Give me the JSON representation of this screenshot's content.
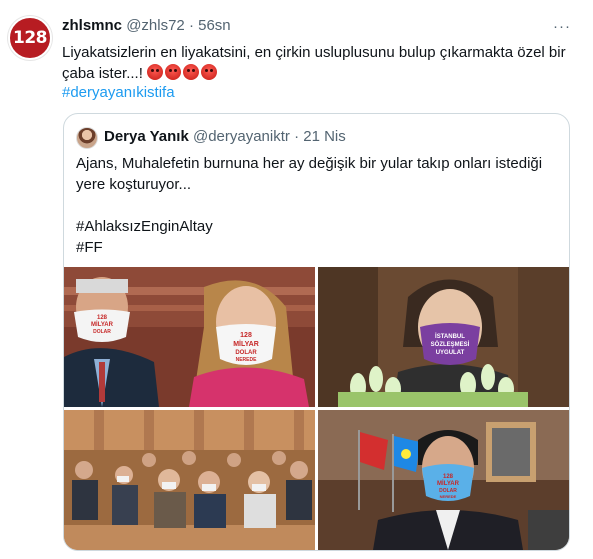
{
  "tweet": {
    "avatar_text": "128",
    "name": "zhlsmnc",
    "handle": "@zhls72",
    "time": "56sn",
    "more_icon": "more-dots-icon",
    "text": "Liyakatsizlerin en liyakatsini, en çirkin usluplusunu bulup çıkarmakta özel bir çaba ister...!",
    "emojis": [
      "angry-face",
      "angry-face",
      "angry-face",
      "angry-face"
    ],
    "hashtag": "#deryayanıkistifa"
  },
  "quote": {
    "name": "Derya Yanık",
    "handle": "@deryayaniktr",
    "time": "21 Nis",
    "text": "Ajans, Muhalefetin burnuna her ay değişik bir yular takıp onları istediği yere koşturuyor...\n\n#AhlaksızEnginAltay\n#FF",
    "photos": {
      "p1_mask_left": [
        "128",
        "MİLYAR",
        "DOLAR",
        "NEREDE"
      ],
      "p1_mask_right": [
        "128",
        "MİLYAR",
        "DOLAR",
        "NEREDE"
      ],
      "p2_mask": [
        "İSTANBUL",
        "SÖZLEŞMESİ",
        "UYGULAT"
      ],
      "p4_mask": [
        "128",
        "MİLYAR",
        "DOLAR",
        "NEREDE"
      ]
    }
  }
}
